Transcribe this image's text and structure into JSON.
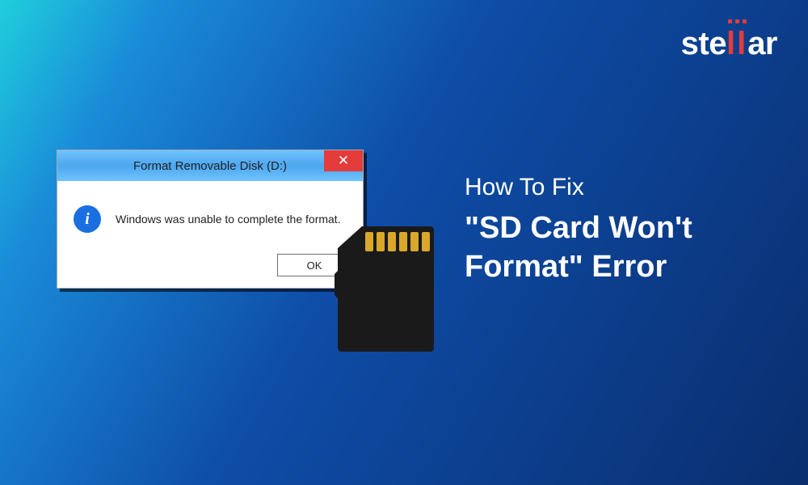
{
  "brand": {
    "name_part1": "ste",
    "name_part2": "ll",
    "name_part3": "ar"
  },
  "dialog": {
    "title": "Format Removable Disk (D:)",
    "close_label": "✕",
    "info_symbol": "i",
    "message": "Windows was unable to complete the format.",
    "ok_label": "OK"
  },
  "headline": {
    "line1": "How To Fix",
    "line2": "\"SD Card Won't Format\" Error"
  }
}
